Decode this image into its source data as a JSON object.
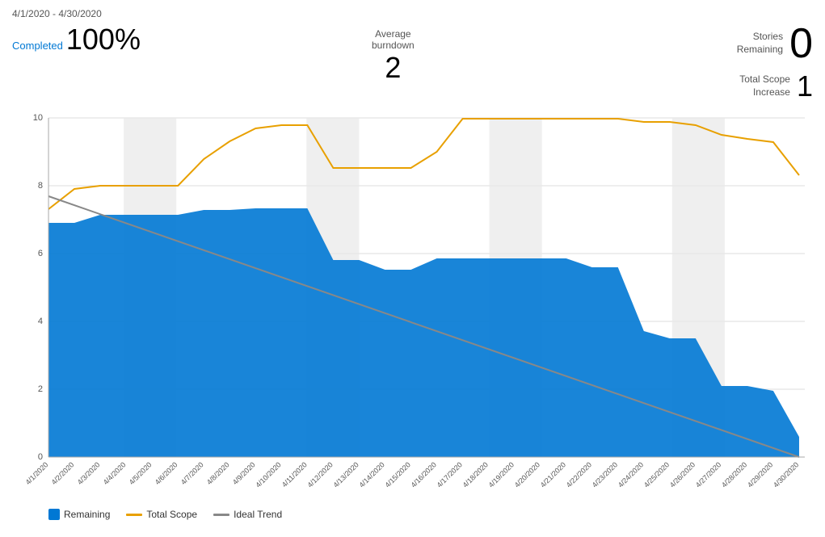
{
  "header": {
    "date_range": "4/1/2020 - 4/30/2020"
  },
  "stats": {
    "completed_label": "Completed",
    "completed_value": "100%",
    "avg_burndown_label": "Average\nburndown",
    "avg_burndown_value": "2",
    "stories_remaining_label": "Stories\nRemaining",
    "stories_remaining_value": "0",
    "total_scope_label": "Total Scope\nIncrease",
    "total_scope_value": "1"
  },
  "legend": {
    "remaining_label": "Remaining",
    "total_scope_label": "Total Scope",
    "ideal_trend_label": "Ideal Trend",
    "remaining_color": "#0078d4",
    "total_scope_color": "#e8a000",
    "ideal_trend_color": "#888888"
  },
  "chart": {
    "y_labels": [
      "0",
      "2",
      "4",
      "6",
      "8",
      "10"
    ],
    "x_labels": [
      "4/1/2020",
      "4/2/2020",
      "4/3/2020",
      "4/4/2020",
      "4/5/2020",
      "4/6/2020",
      "4/7/2020",
      "4/8/2020",
      "4/9/2020",
      "4/10/2020",
      "4/11/2020",
      "4/12/2020",
      "4/13/2020",
      "4/14/2020",
      "4/15/2020",
      "4/16/2020",
      "4/17/2020",
      "4/18/2020",
      "4/19/2020",
      "4/20/2020",
      "4/21/2020",
      "4/22/2020",
      "4/23/2020",
      "4/24/2020",
      "4/25/2020",
      "4/26/2020",
      "4/27/2020",
      "4/28/2020",
      "4/29/2020",
      "4/30/2020"
    ]
  }
}
